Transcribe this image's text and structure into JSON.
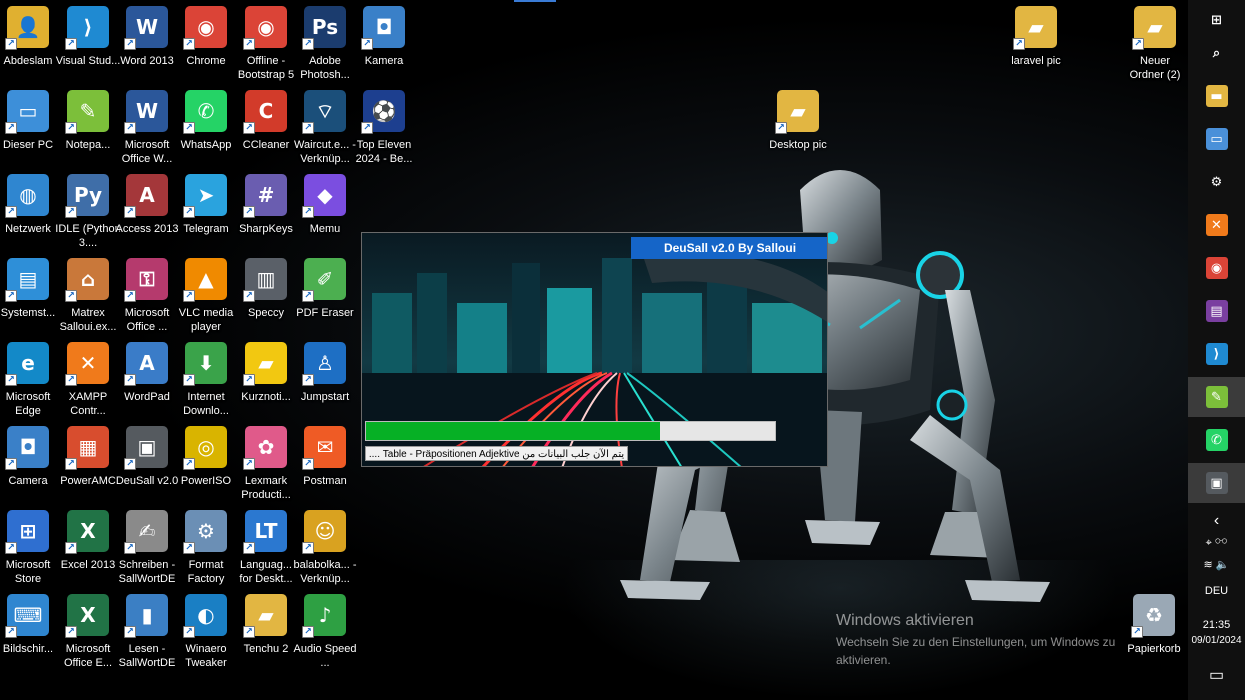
{
  "desktop": {
    "icons": [
      {
        "label": "Abdeslam",
        "icon": "user-folder-icon",
        "color": "#e0b030",
        "glyph": "👤"
      },
      {
        "label": "Visual Stud...",
        "icon": "vscode-icon",
        "color": "#1f8ad2",
        "glyph": "⟩"
      },
      {
        "label": "Word 2013",
        "icon": "word-icon",
        "color": "#2b579a",
        "glyph": "W"
      },
      {
        "label": "Chrome",
        "icon": "chrome-icon",
        "color": "#db4437",
        "glyph": "◉"
      },
      {
        "label": "Offline - Bootstrap 5",
        "icon": "chrome-icon",
        "color": "#db4437",
        "glyph": "◉"
      },
      {
        "label": "Adobe Photosh...",
        "icon": "photoshop-icon",
        "color": "#1b3c6e",
        "glyph": "Ps"
      },
      {
        "label": "Kamera",
        "icon": "camera-icon",
        "color": "#3a80c8",
        "glyph": "◘"
      },
      {
        "label": "Dieser PC",
        "icon": "computer-icon",
        "color": "#3d8fd9",
        "glyph": "▭"
      },
      {
        "label": "Notepa...",
        "icon": "notepad-icon",
        "color": "#7cbf3a",
        "glyph": "✎"
      },
      {
        "label": "Microsoft Office W...",
        "icon": "word-icon",
        "color": "#2b579a",
        "glyph": "W"
      },
      {
        "label": "WhatsApp",
        "icon": "whatsapp-icon",
        "color": "#25d366",
        "glyph": "✆"
      },
      {
        "label": "CCleaner",
        "icon": "ccleaner-icon",
        "color": "#d23b2a",
        "glyph": "C"
      },
      {
        "label": "Waircut.e... - Verknüp...",
        "icon": "wifi-icon",
        "color": "#1b4f7a",
        "glyph": "⌔"
      },
      {
        "label": "Top Eleven 2024 - Be...",
        "icon": "game-icon",
        "color": "#1d3f8f",
        "glyph": "⚽"
      },
      {
        "label": "Netzwerk",
        "icon": "network-icon",
        "color": "#2f86d0",
        "glyph": "◍"
      },
      {
        "label": "IDLE (Python 3....",
        "icon": "python-icon",
        "color": "#3f6ea8",
        "glyph": "Py"
      },
      {
        "label": "Access 2013",
        "icon": "access-icon",
        "color": "#a4373a",
        "glyph": "A"
      },
      {
        "label": "Telegram",
        "icon": "telegram-icon",
        "color": "#2aa3de",
        "glyph": "➤"
      },
      {
        "label": "SharpKeys",
        "icon": "keyboard-icon",
        "color": "#6a5db0",
        "glyph": "#"
      },
      {
        "label": "Memu",
        "icon": "memu-icon",
        "color": "#7b4ee0",
        "glyph": "◆"
      },
      {
        "label": "Systemst...",
        "icon": "system-icon",
        "color": "#2e8fd8",
        "glyph": "▤"
      },
      {
        "label": "Matrex Salloui.ex...",
        "icon": "house-icon",
        "color": "#c9783a",
        "glyph": "⌂"
      },
      {
        "label": "Microsoft Office ...",
        "icon": "office-key-icon",
        "color": "#b53a6d",
        "glyph": "⚿"
      },
      {
        "label": "VLC media player",
        "icon": "vlc-icon",
        "color": "#f08a00",
        "glyph": "▲"
      },
      {
        "label": "Speccy",
        "icon": "speccy-icon",
        "color": "#5a6068",
        "glyph": "▥"
      },
      {
        "label": "PDF Eraser",
        "icon": "eraser-icon",
        "color": "#4caf50",
        "glyph": "✐"
      },
      {
        "label": "Microsoft Edge",
        "icon": "edge-icon",
        "color": "#1389c8",
        "glyph": "e"
      },
      {
        "label": "XAMPP Contr...",
        "icon": "xampp-icon",
        "color": "#f07a1b",
        "glyph": "✕"
      },
      {
        "label": "WordPad",
        "icon": "wordpad-icon",
        "color": "#3a7cc8",
        "glyph": "A"
      },
      {
        "label": "Internet Downlo...",
        "icon": "download-icon",
        "color": "#3aa34a",
        "glyph": "⬇"
      },
      {
        "label": "Kurznoti...",
        "icon": "sticky-note-icon",
        "color": "#f2c811",
        "glyph": "▰"
      },
      {
        "label": "Jumpstart",
        "icon": "jumpstart-icon",
        "color": "#1e6fc4",
        "glyph": "♙"
      },
      {
        "label": "Camera",
        "icon": "camera-icon",
        "color": "#3a80c8",
        "glyph": "◘"
      },
      {
        "label": "PowerAMC",
        "icon": "poweramc-icon",
        "color": "#d84d2e",
        "glyph": "▦"
      },
      {
        "label": "DeuSall v2.0",
        "icon": "deusall-icon",
        "color": "#555a5f",
        "glyph": "▣"
      },
      {
        "label": "PowerISO",
        "icon": "disc-icon",
        "color": "#d9b400",
        "glyph": "◎"
      },
      {
        "label": "Lexmark Producti...",
        "icon": "lexmark-icon",
        "color": "#e05a8a",
        "glyph": "✿"
      },
      {
        "label": "Postman",
        "icon": "postman-icon",
        "color": "#ef5b25",
        "glyph": "✉"
      },
      {
        "label": "Microsoft Store",
        "icon": "store-icon",
        "color": "#2f6fd0",
        "glyph": "⊞"
      },
      {
        "label": "Excel 2013",
        "icon": "excel-icon",
        "color": "#217346",
        "glyph": "X"
      },
      {
        "label": "Schreiben - SallWortDE",
        "icon": "document-icon",
        "color": "#8a8a8a",
        "glyph": "✍"
      },
      {
        "label": "Format Factory",
        "icon": "format-factory-icon",
        "color": "#6b8fb5",
        "glyph": "⚙"
      },
      {
        "label": "Languag... for Deskt...",
        "icon": "language-icon",
        "color": "#2b78d0",
        "glyph": "LT"
      },
      {
        "label": "balabolka... - Verknüp...",
        "icon": "balabolka-icon",
        "color": "#d9a220",
        "glyph": "☺"
      },
      {
        "label": "Bildschir...",
        "icon": "keyboard-icon",
        "color": "#2f86d0",
        "glyph": "⌨"
      },
      {
        "label": "Microsoft Office E...",
        "icon": "excel-icon",
        "color": "#217346",
        "glyph": "X"
      },
      {
        "label": "Lesen - SallWortDE",
        "icon": "book-icon",
        "color": "#3b7fc4",
        "glyph": "▮"
      },
      {
        "label": "Winaero Tweaker",
        "icon": "winaero-icon",
        "color": "#1a7fc4",
        "glyph": "◐"
      },
      {
        "label": "Tenchu 2",
        "icon": "folder-icon",
        "color": "#e2b642",
        "glyph": "▰"
      },
      {
        "label": "Audio Speed ...",
        "icon": "music-icon",
        "color": "#2ea043",
        "glyph": "♪"
      }
    ],
    "extra_icons": [
      {
        "label": "laravel pic",
        "icon": "folder-icon",
        "color": "#e2b642",
        "glyph": "▰"
      },
      {
        "label": "Neuer Ordner (2)",
        "icon": "folder-icon",
        "color": "#e2b642",
        "glyph": "▰"
      },
      {
        "label": "Desktop pic",
        "icon": "folder-icon",
        "color": "#e2b642",
        "glyph": "▰"
      },
      {
        "label": "Papierkorb",
        "icon": "recycle-bin-icon",
        "color": "#9aa8b5",
        "glyph": "♻"
      }
    ]
  },
  "app": {
    "title": "DeuSall v2.0 By Salloui",
    "progress": 0.72,
    "status": "يتم الآن جلب البيانات من Table - Präpositionen Adjektive ....",
    "colors": {
      "title_bg": "#1565c8",
      "progress": "#06b025"
    }
  },
  "watermark": {
    "title": "Windows aktivieren",
    "subtitle": "Wechseln Sie zu den Einstellungen, um Windows zu aktivieren."
  },
  "taskbar": {
    "items": [
      {
        "icon": "windows-start-icon",
        "glyph": "⊞",
        "color": "transparent",
        "active": false
      },
      {
        "icon": "search-icon",
        "glyph": "⌕",
        "color": "transparent",
        "active": false
      },
      {
        "icon": "file-explorer-icon",
        "glyph": "▬",
        "color": "#e2b642",
        "active": false
      },
      {
        "icon": "remote-desktop-icon",
        "glyph": "▭",
        "color": "#4a90d9",
        "active": false
      },
      {
        "icon": "settings-icon",
        "glyph": "⚙",
        "color": "transparent",
        "active": false
      },
      {
        "icon": "xampp-icon",
        "glyph": "✕",
        "color": "#f07a1b",
        "active": false
      },
      {
        "icon": "chrome-icon",
        "glyph": "◉",
        "color": "#db4437",
        "active": false
      },
      {
        "icon": "winrar-icon",
        "glyph": "▤",
        "color": "#7a3fa0",
        "active": false
      },
      {
        "icon": "vscode-icon",
        "glyph": "⟩",
        "color": "#1f8ad2",
        "active": false
      },
      {
        "icon": "notepad-icon",
        "glyph": "✎",
        "color": "#7cbf3a",
        "active": true
      },
      {
        "icon": "whatsapp-icon",
        "glyph": "✆",
        "color": "#25d366",
        "active": false
      },
      {
        "icon": "deusall-icon",
        "glyph": "▣",
        "color": "#555a5f",
        "active": true
      }
    ],
    "tray": {
      "chevron": "‹",
      "language": "DEU",
      "time": "21:35",
      "date": "09/01/2024"
    }
  }
}
